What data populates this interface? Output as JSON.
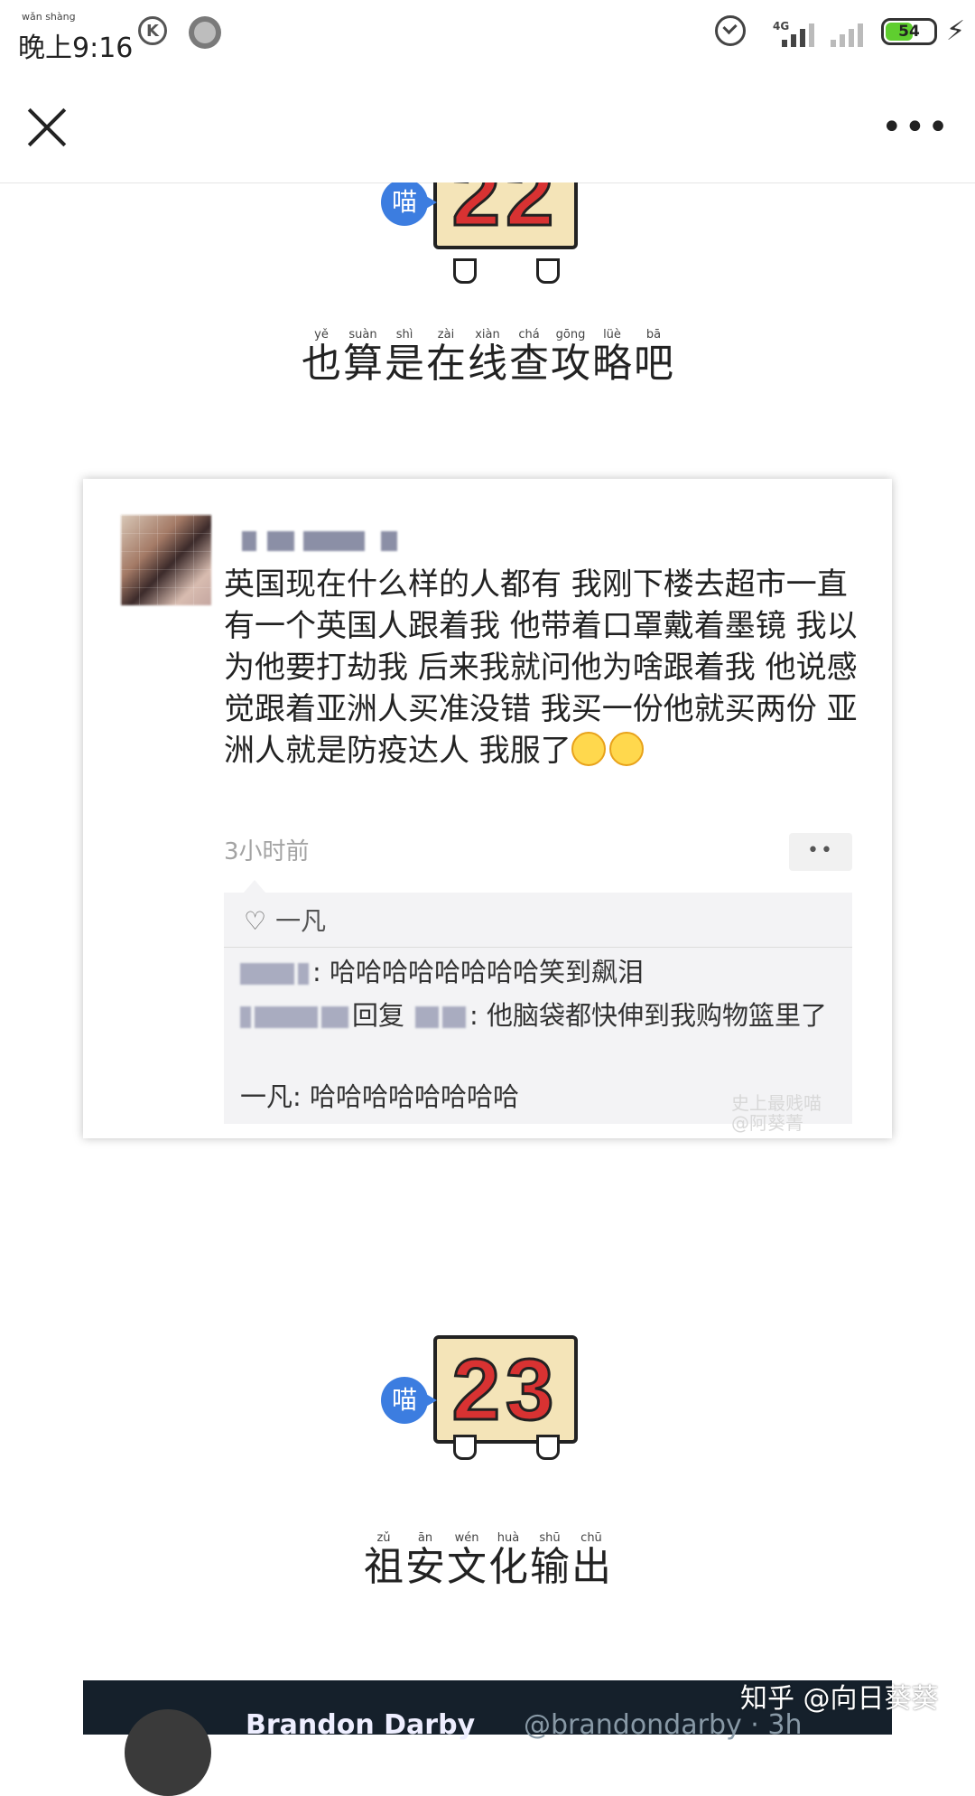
{
  "status_bar": {
    "time_ruby": "wǎn shàng",
    "time": "晚上9:16",
    "network": "4G",
    "battery": "54",
    "icons": [
      "k-app-icon",
      "progress-ring-icon",
      "alarm-icon",
      "signal-icon",
      "signal-icon",
      "battery-icon",
      "charging-bolt-icon"
    ]
  },
  "nav": {
    "close_icon": "close-icon",
    "more_label": "•••"
  },
  "sections": [
    {
      "number": "22",
      "badge": "喵",
      "title_chars": [
        {
          "c": "也",
          "p": "yě"
        },
        {
          "c": "算",
          "p": "suàn"
        },
        {
          "c": "是",
          "p": "shì"
        },
        {
          "c": "在",
          "p": "zài"
        },
        {
          "c": "线",
          "p": "xiàn"
        },
        {
          "c": "查",
          "p": "chá"
        },
        {
          "c": "攻",
          "p": "gōng"
        },
        {
          "c": "略",
          "p": "lüè"
        },
        {
          "c": "吧",
          "p": "bā"
        }
      ]
    },
    {
      "number": "23",
      "badge": "喵",
      "title_chars": [
        {
          "c": "祖",
          "p": "zǔ"
        },
        {
          "c": "安",
          "p": "ān"
        },
        {
          "c": "文",
          "p": "wén"
        },
        {
          "c": "化",
          "p": "huà"
        },
        {
          "c": "输",
          "p": "shū"
        },
        {
          "c": "出",
          "p": "chū"
        }
      ]
    }
  ],
  "post": {
    "text": "英国现在什么样的人都有 我刚下楼去超市一直有一个英国人跟着我 他带着口罩戴着墨镜 我以为他要打劫我 后来我就问他为啥跟着我 他说感觉跟着亚洲人买准没错 我买一份他就买两份 亚洲人就是防疫达人 我服了",
    "time": "3小时前",
    "more_label": "••",
    "like_name": "一凡",
    "comments": [
      {
        "text": ": 哈哈哈哈哈哈哈哈笑到飙泪"
      },
      {
        "reply": "回复",
        "text": ": 他脑袋都快伸到我购物篮里了"
      },
      {
        "author": "一凡",
        "text": ": 哈哈哈哈哈哈哈哈"
      }
    ],
    "watermark_1": "史上最贱喵",
    "watermark_2": "@阿葵菁"
  },
  "next_post": {
    "name": "Brandon Darby",
    "handle": "@brandondarby · 3h"
  },
  "zhihu_watermark": "知乎 @向日葵葵"
}
